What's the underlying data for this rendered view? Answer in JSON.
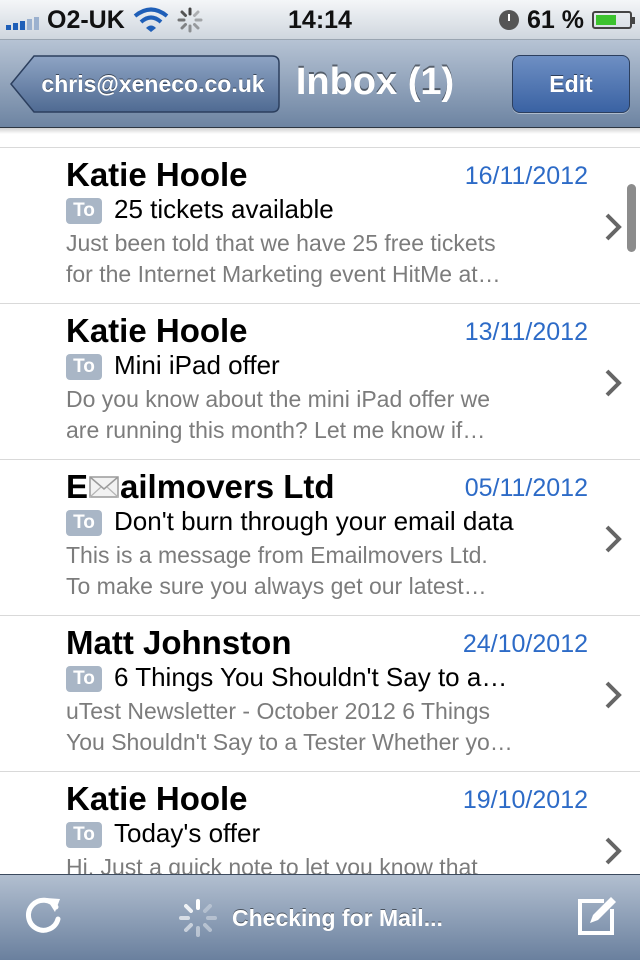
{
  "status_bar": {
    "carrier": "O2-UK",
    "time": "14:14",
    "battery_percent": "61 %",
    "battery_level": 0.61,
    "icons": [
      "signal-icon",
      "wifi-icon",
      "activity-spinner-icon",
      "alarm-icon",
      "battery-icon"
    ]
  },
  "nav": {
    "back_label": "chris@xeneco.co.uk",
    "title": "Inbox (1)",
    "edit_label": "Edit"
  },
  "messages": [
    {
      "sender": "Katie Hoole",
      "date": "16/11/2012",
      "to_badge": "To",
      "subject": "25 tickets available",
      "preview_line1": "Just been told that we have 25 free tickets",
      "preview_line2": "for the Internet Marketing event HitMe at…"
    },
    {
      "sender": "Katie Hoole",
      "date": "13/11/2012",
      "to_badge": "To",
      "subject": "Mini iPad offer",
      "preview_line1": "Do you know about the mini iPad offer we",
      "preview_line2": "are running this month? Let me know if…"
    },
    {
      "sender_prefix": "E",
      "sender_suffix": "ailmovers Ltd",
      "date": "05/11/2012",
      "to_badge": "To",
      "subject": "Don't burn through your email data",
      "preview_line1": "This is a message from Emailmovers Ltd.",
      "preview_line2": "To make sure you always get our latest…"
    },
    {
      "sender": "Matt Johnston",
      "date": "24/10/2012",
      "to_badge": "To",
      "subject": "6 Things You Shouldn't Say to a…",
      "preview_line1": "uTest Newsletter - October 2012 6 Things",
      "preview_line2": "You Shouldn't Say to a Tester Whether yo…"
    },
    {
      "sender": "Katie Hoole",
      "date": "19/10/2012",
      "to_badge": "To",
      "subject": "Today's offer",
      "preview_line1": "Hi, Just a quick note to let you know that"
    }
  ],
  "toolbar": {
    "status": "Checking for Mail...",
    "icons": [
      "refresh-icon",
      "activity-spinner-icon",
      "compose-icon"
    ]
  },
  "colors": {
    "date_blue": "#2d6bc7",
    "nav_bar": "#6d84a2",
    "edit_button": "#3a62a3",
    "to_badge": "#a9b6c6"
  }
}
